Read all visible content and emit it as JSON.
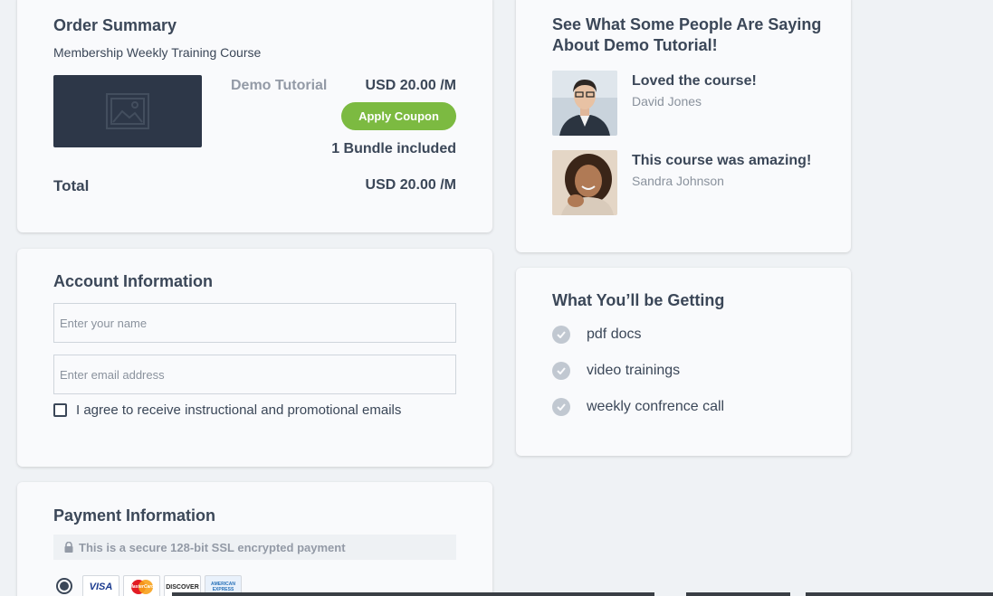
{
  "order": {
    "title": "Order Summary",
    "subtitle": "Membership Weekly Training Course",
    "product_name": "Demo Tutorial",
    "price": "USD 20.00 /M",
    "coupon_label": "Apply Coupon",
    "bundle_text": "1 Bundle included",
    "total_label": "Total",
    "total_value": "USD 20.00 /M"
  },
  "account": {
    "title": "Account Information",
    "name_placeholder": "Enter your name",
    "email_placeholder": "Enter email address",
    "agree_label": "I agree to receive instructional and promotional emails"
  },
  "payment": {
    "title": "Payment Information",
    "secure_text": "This is a secure 128-bit SSL encrypted payment",
    "cards": [
      "VISA",
      "MasterCard",
      "DISCOVER",
      "AMERICAN EXPRESS"
    ]
  },
  "testimonials": {
    "title": "See What Some People Are Saying About Demo Tutorial!",
    "items": [
      {
        "quote": "Loved the course!",
        "author": "David Jones"
      },
      {
        "quote": "This course was amazing!",
        "author": "Sandra Johnson"
      }
    ]
  },
  "features": {
    "title": "What You’ll be Getting",
    "items": [
      {
        "label": "pdf docs"
      },
      {
        "label": "video trainings"
      },
      {
        "label": "weekly confrence call"
      }
    ]
  },
  "colors": {
    "accent_green": "#7cba41",
    "text_dark": "#3b4758",
    "text_muted": "#939aa6",
    "thumb_bg": "#2d3748"
  }
}
